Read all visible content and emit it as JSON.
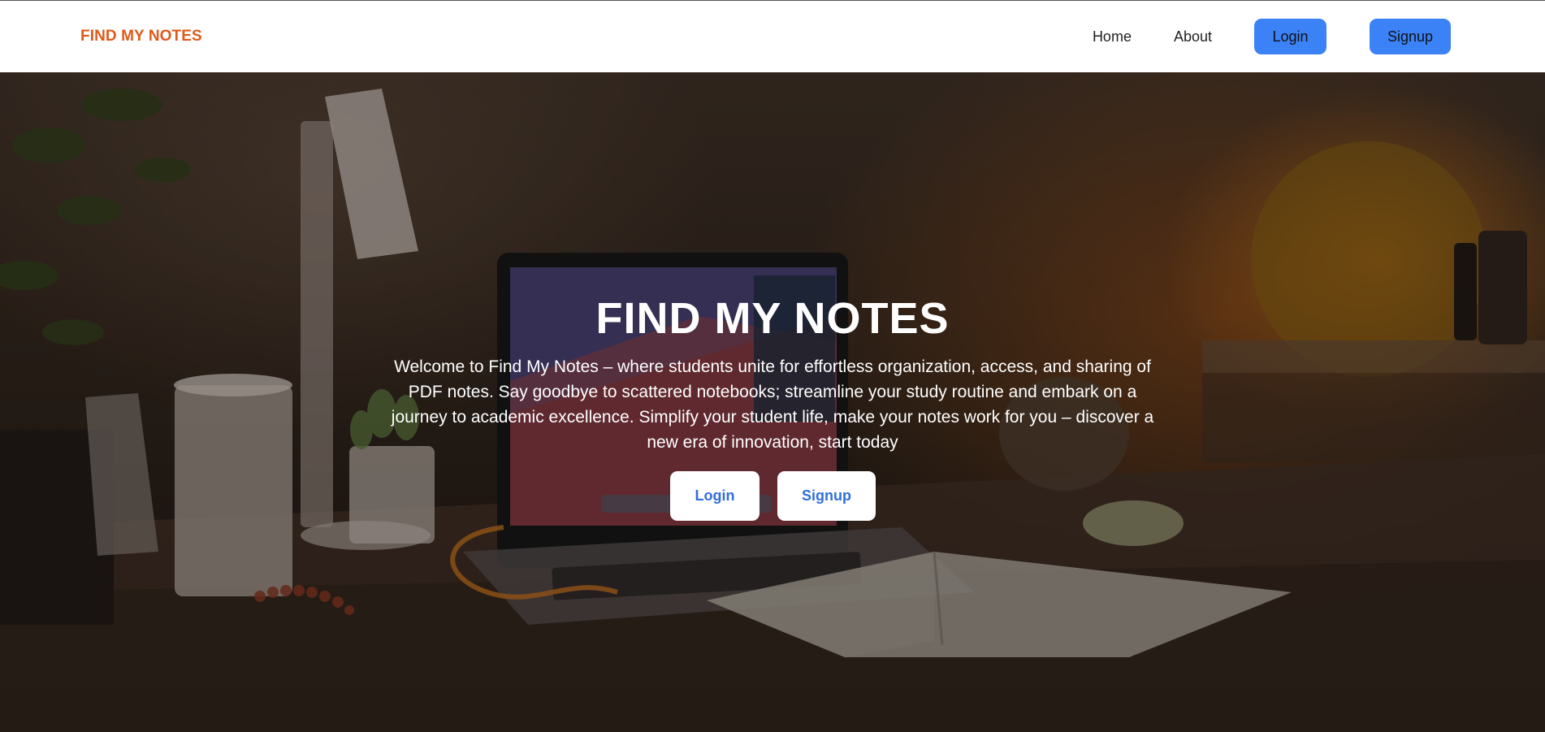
{
  "navbar": {
    "brand": "FIND MY NOTES",
    "links": {
      "home": "Home",
      "about": "About"
    },
    "login_label": "Login",
    "signup_label": "Signup"
  },
  "hero": {
    "title": "FIND MY NOTES",
    "description": "Welcome to Find My Notes – where students unite for effortless organization, access, and sharing of PDF notes. Say goodbye to scattered notebooks; streamline your study routine and embark on a journey to academic excellence. Simplify your student life, make your notes work for you – discover a new era of innovation, start today",
    "login_label": "Login",
    "signup_label": "Signup"
  },
  "colors": {
    "brand": "#e1591a",
    "nav_button": "#3b82f6",
    "hero_button_text": "#2f6fdc",
    "hero_text": "#ffffff"
  }
}
